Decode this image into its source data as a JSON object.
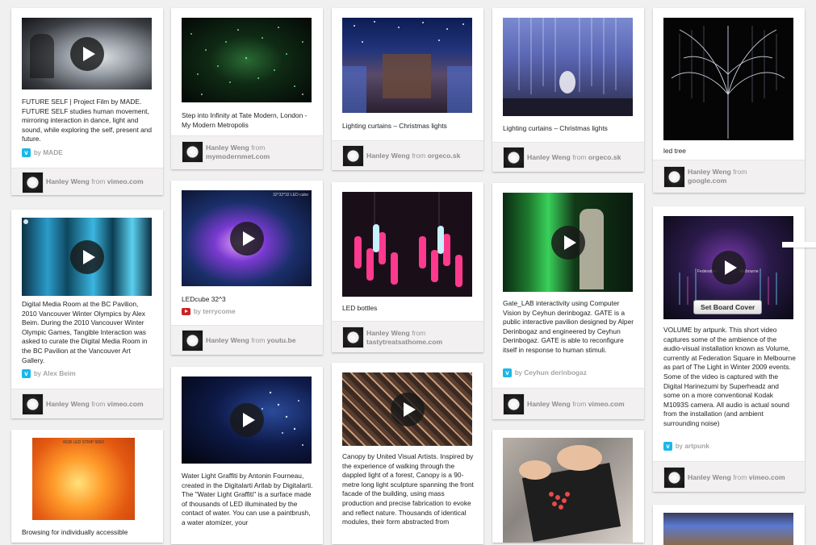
{
  "pins": [
    {
      "id": "p1",
      "desc": "FUTURE SELF | Project Film by MADE. FUTURE SELF studies human movement, mirroring interaction in dance, light and sound, while exploring the self, present and future.",
      "via": "by",
      "via_name": "MADE",
      "user": "Hanley Weng",
      "from": "from",
      "domain": "vimeo.com"
    },
    {
      "id": "p2",
      "desc": "Step into Infinity at Tate Modern, London - My Modern Metropolis",
      "user": "Hanley Weng",
      "from": "from",
      "domain": "mymodernmet.com"
    },
    {
      "id": "p3",
      "desc": "Lighting curtains – Christmas lights",
      "user": "Hanley Weng",
      "from": "from",
      "domain": "orgeco.sk"
    },
    {
      "id": "p4",
      "desc": "Lighting curtains – Christmas lights",
      "user": "Hanley Weng",
      "from": "from",
      "domain": "orgeco.sk"
    },
    {
      "id": "p5",
      "desc": "led tree",
      "user": "Hanley Weng",
      "from": "from",
      "domain": "google.com"
    },
    {
      "id": "p6",
      "desc": "Digital Media Room at the BC Pavilion, 2010 Vancouver Winter Olympics by Alex Beim. During the 2010 Vancouver Winter Olympic Games, Tangible Interaction was asked to curate the Digital Media Room in the BC Pavilion at the Vancouver Art Gallery.",
      "via": "by",
      "via_name": "Alex Beim",
      "user": "Hanley Weng",
      "from": "from",
      "domain": "vimeo.com"
    },
    {
      "id": "p7",
      "desc": "LEDcube 32^3",
      "via": "by",
      "via_name": "terrycome",
      "user": "Hanley Weng",
      "from": "from",
      "domain": "youtu.be",
      "img_caption": "32*32*32 LED cube"
    },
    {
      "id": "p8",
      "desc": "LED bottles",
      "user": "Hanley Weng",
      "from": "from",
      "domain": "tastytreatsathome.com"
    },
    {
      "id": "p9",
      "desc": "Gate_LAB interactivity using Computer Vision by Ceyhun derinbogaz. GATE is a public interactive pavilion designed by Alper Derinbogaz and engineered by Ceyhun Derinbogaz. GATE is able to reconfigure itself in response to human stimuli.",
      "via": "by",
      "via_name": "Ceyhun derinbogaz",
      "user": "Hanley Weng",
      "from": "from",
      "domain": "vimeo.com"
    },
    {
      "id": "p10",
      "desc": "VOLUME by artpunk. This short video captures some of the ambience of the audio-visual installation known as Volume, currently at Federation Square in Melbourne as part of The Light in Winter 2009 events. Some of the video is captured with the Digital Harinezumi by Superheadz and some on a more conventional Kodak M1093S camera. All audio is actual sound from the installation (and ambient surrounding noise)",
      "via": "by",
      "via_name": "artpunk",
      "user": "Hanley Weng",
      "from": "from",
      "domain": "vimeo.com",
      "button": "Set Board Cover",
      "img_caption_a": "Federation",
      "img_caption_b": "Melbourne"
    },
    {
      "id": "p11",
      "desc": "Browsing for individually accessible",
      "img_caption": "RGB LED STRIP 5050"
    },
    {
      "id": "p12",
      "desc": "Water Light Graffiti by Antonin Fourneau, created in the Digitalarti Artlab by Digitalarti. The \"Water Light Graffiti\" is a surface made of thousands of LED illuminated by the contact of water. You can use a paintbrush, a water atomizer, your"
    },
    {
      "id": "p13",
      "desc": "Canopy by United Visual Artists. Inspired by the experience of walking through the dappled light of a forest, Canopy is a 90-metre long light sculpture spanning the front facade of the building, using mass production and precise fabrication to evoke and reflect nature. Thousands of identical modules, their form abstracted from"
    }
  ],
  "icons": {
    "play": "play-icon",
    "vimeo": "vimeo-icon",
    "youtube": "youtube-icon"
  },
  "colors": {
    "background": "#f1f0f0",
    "vimeo": "#1ab7ea",
    "youtube": "#cc2222"
  }
}
